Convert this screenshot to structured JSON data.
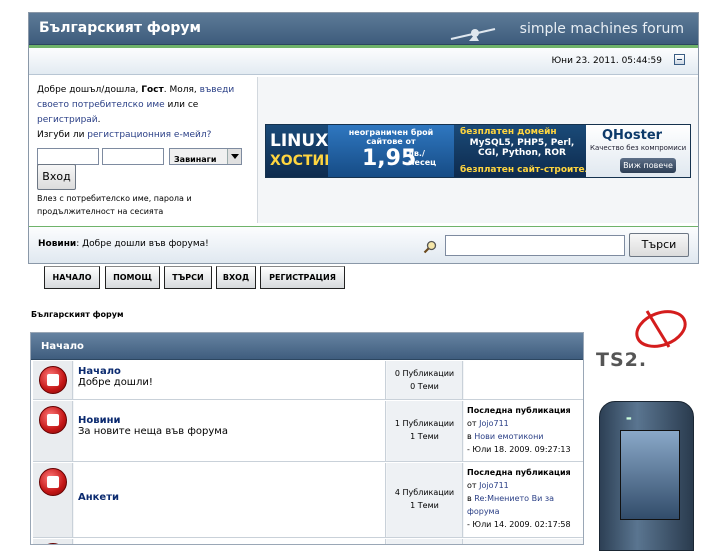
{
  "header": {
    "site_title": "Българският форум",
    "brand": "simple machines forum",
    "date": "Юни 23. 2011. 05:44:59"
  },
  "login": {
    "welcome_pre": "Добре дошъл/дошла, ",
    "guest": "Гост",
    "please": ". Моля, ",
    "login_link": "въведи своето потребителско име",
    "or": " или се ",
    "register_link": "регистрирай",
    "after_register": ".",
    "forgot_pre": "Изгуби ли ",
    "activation_link": "регистрационния е-мейл?",
    "duration_option": "Завинаги",
    "login_button": "Вход",
    "note": "Влез с потребителско име, парола и продължителност на сесията"
  },
  "banner": {
    "linux": "LINUX",
    "hosting": "ХОСТИНГ",
    "unlimited": "неограничен брой сайтове от",
    "price": "1,95",
    "price_unit": "лв./ месец",
    "free_domain": "безплатен домейн",
    "langs": "MySQL5, PHP5, Perl, CGI, Python, ROR",
    "free_builder": "безплатен сайт-строител",
    "qhoster": "QHoster",
    "qhoster_tag": "Качество без компромиси",
    "see_more": "Виж повече"
  },
  "news": {
    "label": "Новини",
    "text": ": Добре дошли във форума!"
  },
  "search": {
    "button": "Търси"
  },
  "menu": [
    "НАЧАЛО",
    "ПОМОЩ",
    "ТЪРСИ",
    "ВХОД",
    "РЕГИСТРАЦИЯ"
  ],
  "breadcrumb": "Българският форум",
  "category": "Начало",
  "boards": [
    {
      "name": "Начало",
      "desc": "Добре дошли!",
      "posts": "0 Публикации",
      "topics": "0 Теми",
      "last": null
    },
    {
      "name": "Новини",
      "desc": "За новите неща във форума",
      "posts": "1 Публикации",
      "topics": "1 Теми",
      "last": {
        "label": "Последна публикация",
        "by": "от ",
        "user": "Jojo711",
        "in": "в ",
        "topic": "Нови емотикони",
        "date": "- Юли 18. 2009. 09:27:13"
      }
    },
    {
      "name": "Анкети",
      "desc": "",
      "posts": "4 Публикации",
      "topics": "1 Теми",
      "last": {
        "label": "Последна публикация",
        "by": "от ",
        "user": "Jojo711",
        "in": "в ",
        "topic": "Re:Мнението Ви за форума",
        "date": "- Юли 14. 2009. 02:17:58"
      }
    }
  ],
  "side_ad": {
    "logo_text": "TS2."
  }
}
